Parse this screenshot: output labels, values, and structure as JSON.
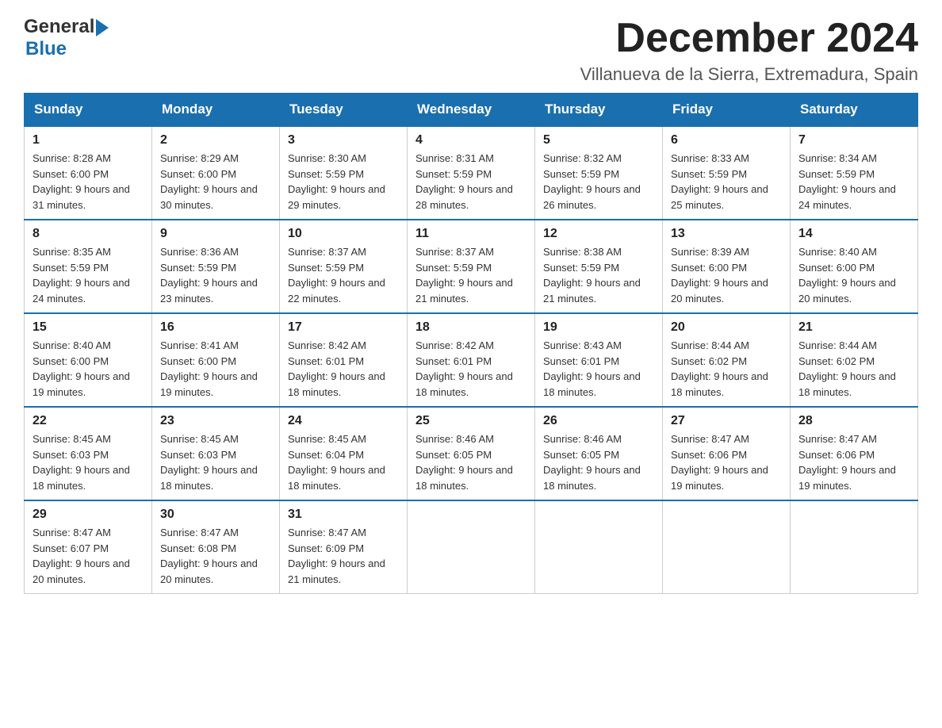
{
  "header": {
    "logo_general": "General",
    "logo_blue": "Blue",
    "month_title": "December 2024",
    "location": "Villanueva de la Sierra, Extremadura, Spain"
  },
  "weekdays": [
    "Sunday",
    "Monday",
    "Tuesday",
    "Wednesday",
    "Thursday",
    "Friday",
    "Saturday"
  ],
  "weeks": [
    [
      {
        "day": "1",
        "sunrise": "8:28 AM",
        "sunset": "6:00 PM",
        "daylight": "9 hours and 31 minutes."
      },
      {
        "day": "2",
        "sunrise": "8:29 AM",
        "sunset": "6:00 PM",
        "daylight": "9 hours and 30 minutes."
      },
      {
        "day": "3",
        "sunrise": "8:30 AM",
        "sunset": "5:59 PM",
        "daylight": "9 hours and 29 minutes."
      },
      {
        "day": "4",
        "sunrise": "8:31 AM",
        "sunset": "5:59 PM",
        "daylight": "9 hours and 28 minutes."
      },
      {
        "day": "5",
        "sunrise": "8:32 AM",
        "sunset": "5:59 PM",
        "daylight": "9 hours and 26 minutes."
      },
      {
        "day": "6",
        "sunrise": "8:33 AM",
        "sunset": "5:59 PM",
        "daylight": "9 hours and 25 minutes."
      },
      {
        "day": "7",
        "sunrise": "8:34 AM",
        "sunset": "5:59 PM",
        "daylight": "9 hours and 24 minutes."
      }
    ],
    [
      {
        "day": "8",
        "sunrise": "8:35 AM",
        "sunset": "5:59 PM",
        "daylight": "9 hours and 24 minutes."
      },
      {
        "day": "9",
        "sunrise": "8:36 AM",
        "sunset": "5:59 PM",
        "daylight": "9 hours and 23 minutes."
      },
      {
        "day": "10",
        "sunrise": "8:37 AM",
        "sunset": "5:59 PM",
        "daylight": "9 hours and 22 minutes."
      },
      {
        "day": "11",
        "sunrise": "8:37 AM",
        "sunset": "5:59 PM",
        "daylight": "9 hours and 21 minutes."
      },
      {
        "day": "12",
        "sunrise": "8:38 AM",
        "sunset": "5:59 PM",
        "daylight": "9 hours and 21 minutes."
      },
      {
        "day": "13",
        "sunrise": "8:39 AM",
        "sunset": "6:00 PM",
        "daylight": "9 hours and 20 minutes."
      },
      {
        "day": "14",
        "sunrise": "8:40 AM",
        "sunset": "6:00 PM",
        "daylight": "9 hours and 20 minutes."
      }
    ],
    [
      {
        "day": "15",
        "sunrise": "8:40 AM",
        "sunset": "6:00 PM",
        "daylight": "9 hours and 19 minutes."
      },
      {
        "day": "16",
        "sunrise": "8:41 AM",
        "sunset": "6:00 PM",
        "daylight": "9 hours and 19 minutes."
      },
      {
        "day": "17",
        "sunrise": "8:42 AM",
        "sunset": "6:01 PM",
        "daylight": "9 hours and 18 minutes."
      },
      {
        "day": "18",
        "sunrise": "8:42 AM",
        "sunset": "6:01 PM",
        "daylight": "9 hours and 18 minutes."
      },
      {
        "day": "19",
        "sunrise": "8:43 AM",
        "sunset": "6:01 PM",
        "daylight": "9 hours and 18 minutes."
      },
      {
        "day": "20",
        "sunrise": "8:44 AM",
        "sunset": "6:02 PM",
        "daylight": "9 hours and 18 minutes."
      },
      {
        "day": "21",
        "sunrise": "8:44 AM",
        "sunset": "6:02 PM",
        "daylight": "9 hours and 18 minutes."
      }
    ],
    [
      {
        "day": "22",
        "sunrise": "8:45 AM",
        "sunset": "6:03 PM",
        "daylight": "9 hours and 18 minutes."
      },
      {
        "day": "23",
        "sunrise": "8:45 AM",
        "sunset": "6:03 PM",
        "daylight": "9 hours and 18 minutes."
      },
      {
        "day": "24",
        "sunrise": "8:45 AM",
        "sunset": "6:04 PM",
        "daylight": "9 hours and 18 minutes."
      },
      {
        "day": "25",
        "sunrise": "8:46 AM",
        "sunset": "6:05 PM",
        "daylight": "9 hours and 18 minutes."
      },
      {
        "day": "26",
        "sunrise": "8:46 AM",
        "sunset": "6:05 PM",
        "daylight": "9 hours and 18 minutes."
      },
      {
        "day": "27",
        "sunrise": "8:47 AM",
        "sunset": "6:06 PM",
        "daylight": "9 hours and 19 minutes."
      },
      {
        "day": "28",
        "sunrise": "8:47 AM",
        "sunset": "6:06 PM",
        "daylight": "9 hours and 19 minutes."
      }
    ],
    [
      {
        "day": "29",
        "sunrise": "8:47 AM",
        "sunset": "6:07 PM",
        "daylight": "9 hours and 20 minutes."
      },
      {
        "day": "30",
        "sunrise": "8:47 AM",
        "sunset": "6:08 PM",
        "daylight": "9 hours and 20 minutes."
      },
      {
        "day": "31",
        "sunrise": "8:47 AM",
        "sunset": "6:09 PM",
        "daylight": "9 hours and 21 minutes."
      },
      null,
      null,
      null,
      null
    ]
  ]
}
